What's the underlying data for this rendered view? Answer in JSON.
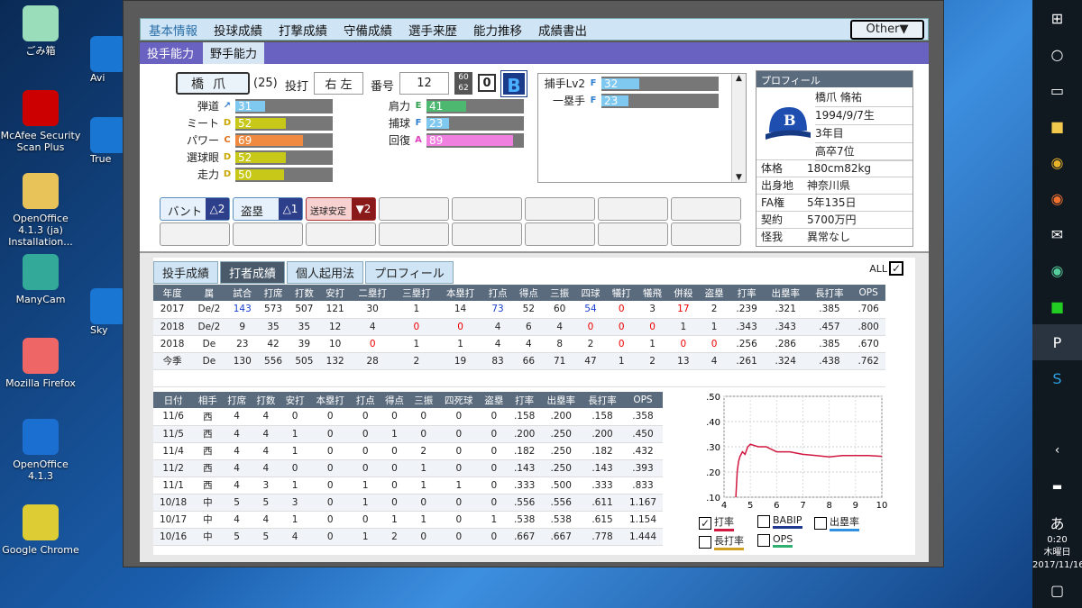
{
  "desktop": {
    "icons": [
      {
        "label": "ごみ箱",
        "icon": "recycle-bin-icon",
        "color": "#9db"
      },
      {
        "label": "McAfee Security Scan Plus",
        "icon": "mcafee-icon",
        "color": "#c00"
      },
      {
        "label": "OpenOffice 4.1.3 (ja) Installation...",
        "icon": "folder-icon",
        "color": "#e8c35a"
      },
      {
        "label": "ManyCam",
        "icon": "manycam-icon",
        "color": "#3a9"
      },
      {
        "label": "Mozilla Firefox",
        "icon": "firefox-icon",
        "color": "#e66"
      },
      {
        "label": "OpenOffice 4.1.3",
        "icon": "openoffice-icon",
        "color": "#1a6fd0"
      },
      {
        "label": "Google Chrome",
        "icon": "chrome-icon",
        "color": "#dc3"
      }
    ],
    "partial": {
      "avi": "Avi",
      "true": "True",
      "sky": "Sky"
    }
  },
  "taskbar": {
    "time": "0:20",
    "day": "木曜日",
    "date": "2017/11/16",
    "ime": "あ"
  },
  "menu": {
    "items": [
      "基本情報",
      "投球成績",
      "打撃成績",
      "守備成績",
      "選手来歴",
      "能力推移",
      "成績書出"
    ],
    "other": "Other▼"
  },
  "subtabs": [
    "投手能力",
    "野手能力"
  ],
  "player": {
    "name": "橋爪",
    "age": "(25)",
    "throws_bats_label": "投打",
    "throws_bats": "右 左",
    "number_label": "番号",
    "number": "12",
    "frac_top": "60",
    "frac_bottom": "62",
    "zero": "0",
    "logo": "B"
  },
  "stats_left": [
    {
      "label": "弾道",
      "grade": "↗",
      "value": "31",
      "pct": 0.31,
      "color": "#7fc8f0"
    },
    {
      "label": "ミート",
      "grade": "D",
      "value": "52",
      "pct": 0.52,
      "color": "#c8c818"
    },
    {
      "label": "パワー",
      "grade": "C",
      "value": "69",
      "pct": 0.69,
      "color": "#f08a40"
    },
    {
      "label": "選球眼",
      "grade": "D",
      "value": "52",
      "pct": 0.52,
      "color": "#c8c818"
    },
    {
      "label": "走力",
      "grade": "D",
      "value": "50",
      "pct": 0.5,
      "color": "#c8c818"
    }
  ],
  "stats_right": [
    {
      "label": "肩力",
      "grade": "E",
      "value": "41",
      "pct": 0.41,
      "color": "#4cb870"
    },
    {
      "label": "捕球",
      "grade": "F",
      "value": "23",
      "pct": 0.23,
      "color": "#7fc8f0"
    },
    {
      "label": "回復",
      "grade": "A",
      "value": "89",
      "pct": 0.89,
      "color": "#f080e0"
    }
  ],
  "positions": [
    {
      "label": "捕手Lv2",
      "grade": "F",
      "value": "32",
      "pct": 0.32
    },
    {
      "label": "一塁手",
      "grade": "F",
      "value": "23",
      "pct": 0.23
    }
  ],
  "skills": [
    {
      "label": "バント",
      "value": "△2"
    },
    {
      "label": "盗塁",
      "value": "△1"
    },
    {
      "label": "送球安定",
      "value": "▼2"
    }
  ],
  "profile": {
    "title": "プロフィール",
    "name": "橋爪 脩祐",
    "birth": "1994/9/7生",
    "years": "3年目",
    "draft": "高卒7位",
    "rows": [
      [
        "体格",
        "180cm82kg"
      ],
      [
        "出身地",
        "神奈川県"
      ],
      [
        "FA権",
        "5年135日"
      ],
      [
        "契約",
        "5700万円"
      ],
      [
        "怪我",
        "異常なし"
      ]
    ]
  },
  "lower_tabs": [
    "投手成績",
    "打者成績",
    "個人起用法",
    "プロフィール"
  ],
  "all_label": "ALL",
  "season_table": {
    "headers": [
      "年度",
      "属",
      "試合",
      "打席",
      "打数",
      "安打",
      "二塁打",
      "三塁打",
      "本塁打",
      "打点",
      "得点",
      "三振",
      "四球",
      "犠打",
      "犠飛",
      "併殺",
      "盗塁",
      "打率",
      "出塁率",
      "長打率",
      "OPS"
    ],
    "rows": [
      [
        "2017",
        "De/2",
        "143",
        "573",
        "507",
        "121",
        "30",
        "1",
        "14",
        "73",
        "52",
        "60",
        "54",
        "0",
        "3",
        "17",
        "2",
        ".239",
        ".321",
        ".385",
        ".706"
      ],
      [
        "2018",
        "De/2",
        "9",
        "35",
        "35",
        "12",
        "4",
        "0",
        "0",
        "4",
        "6",
        "4",
        "0",
        "0",
        "0",
        "1",
        "1",
        ".343",
        ".343",
        ".457",
        ".800"
      ],
      [
        "2018",
        "De",
        "23",
        "42",
        "39",
        "10",
        "0",
        "1",
        "1",
        "4",
        "4",
        "8",
        "2",
        "0",
        "1",
        "0",
        "0",
        ".256",
        ".286",
        ".385",
        ".670"
      ],
      [
        "今季",
        "De",
        "130",
        "556",
        "505",
        "132",
        "28",
        "2",
        "19",
        "83",
        "66",
        "71",
        "47",
        "1",
        "2",
        "13",
        "4",
        ".261",
        ".324",
        ".438",
        ".762"
      ]
    ]
  },
  "game_table": {
    "headers": [
      "日付",
      "相手",
      "打席",
      "打数",
      "安打",
      "本塁打",
      "打点",
      "得点",
      "三振",
      "四死球",
      "盗塁",
      "打率",
      "出塁率",
      "長打率",
      "OPS"
    ],
    "rows": [
      [
        "11/6",
        "西",
        "4",
        "4",
        "0",
        "0",
        "0",
        "0",
        "0",
        "0",
        "0",
        ".158",
        ".200",
        ".158",
        ".358"
      ],
      [
        "11/5",
        "西",
        "4",
        "4",
        "1",
        "0",
        "0",
        "1",
        "0",
        "0",
        "0",
        ".200",
        ".250",
        ".200",
        ".450"
      ],
      [
        "11/4",
        "西",
        "4",
        "4",
        "1",
        "0",
        "0",
        "0",
        "2",
        "0",
        "0",
        ".182",
        ".250",
        ".182",
        ".432"
      ],
      [
        "11/2",
        "西",
        "4",
        "4",
        "0",
        "0",
        "0",
        "0",
        "1",
        "0",
        "0",
        ".143",
        ".250",
        ".143",
        ".393"
      ],
      [
        "11/1",
        "西",
        "4",
        "3",
        "1",
        "0",
        "1",
        "0",
        "1",
        "1",
        "0",
        ".333",
        ".500",
        ".333",
        ".833"
      ],
      [
        "10/18",
        "中",
        "5",
        "5",
        "3",
        "0",
        "1",
        "0",
        "0",
        "0",
        "0",
        ".556",
        ".556",
        ".611",
        "1.167"
      ],
      [
        "10/17",
        "中",
        "4",
        "4",
        "1",
        "0",
        "0",
        "1",
        "1",
        "0",
        "1",
        ".538",
        ".538",
        ".615",
        "1.154"
      ],
      [
        "10/16",
        "中",
        "5",
        "5",
        "4",
        "0",
        "1",
        "2",
        "0",
        "0",
        "0",
        ".667",
        ".667",
        ".778",
        "1.444"
      ]
    ]
  },
  "chart_data": {
    "type": "line",
    "xlim": [
      4,
      10
    ],
    "ylim": [
      0.1,
      0.5
    ],
    "x_ticks": [
      "4",
      "5",
      "6",
      "7",
      "8",
      "9",
      "10"
    ],
    "y_ticks": [
      ".50",
      ".40",
      ".30",
      ".20",
      ".10"
    ],
    "series": [
      {
        "name": "打率",
        "color": "#d01840",
        "points": [
          [
            4.45,
            0.1
          ],
          [
            4.5,
            0.2
          ],
          [
            4.55,
            0.24
          ],
          [
            4.6,
            0.26
          ],
          [
            4.7,
            0.28
          ],
          [
            4.8,
            0.27
          ],
          [
            4.9,
            0.3
          ],
          [
            5.0,
            0.31
          ],
          [
            5.3,
            0.3
          ],
          [
            5.6,
            0.3
          ],
          [
            6.0,
            0.28
          ],
          [
            6.5,
            0.28
          ],
          [
            7.0,
            0.27
          ],
          [
            7.5,
            0.265
          ],
          [
            8.0,
            0.26
          ],
          [
            8.5,
            0.265
          ],
          [
            9.0,
            0.265
          ],
          [
            9.5,
            0.265
          ],
          [
            10.0,
            0.262
          ]
        ]
      }
    ],
    "legend": [
      {
        "label": "打率",
        "checked": true,
        "color": "#d01840"
      },
      {
        "label": "BABIP",
        "checked": false,
        "color": "#203890"
      },
      {
        "label": "出塁率",
        "checked": false,
        "color": "#3090e0"
      },
      {
        "label": "長打率",
        "checked": false,
        "color": "#d0a020"
      },
      {
        "label": "OPS",
        "checked": false,
        "color": "#30b070"
      }
    ]
  }
}
